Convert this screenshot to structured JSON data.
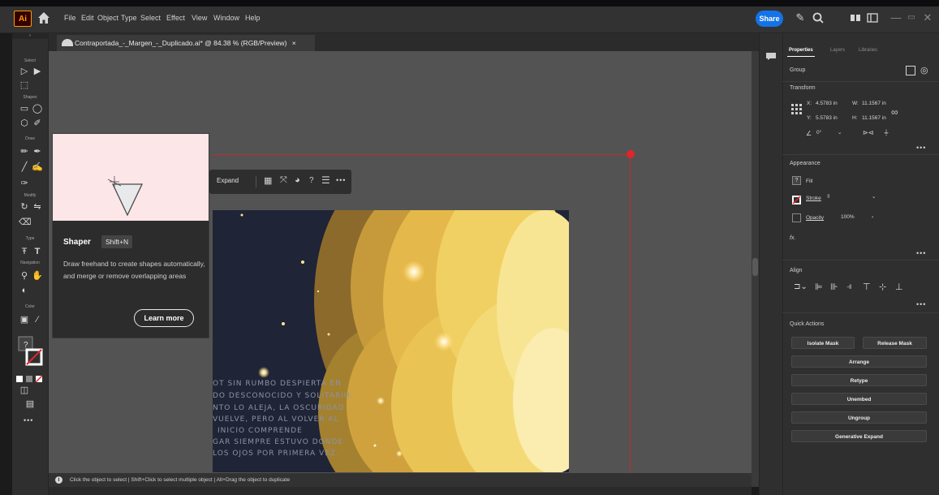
{
  "app": {
    "logo_text": "Ai",
    "menu": [
      "File",
      "Edit",
      "Object",
      "Type",
      "Select",
      "Effect",
      "View",
      "Window",
      "Help"
    ],
    "share_label": "Share"
  },
  "document": {
    "tab_title": "Contraportada_-_Margen_-_Duplicado.ai* @ 84.38 % (RGB/Preview)",
    "close_glyph": "×"
  },
  "toolbar": {
    "sections": [
      "Select",
      "Shapes",
      "Draw",
      "Modify",
      "Type",
      "Navigation",
      "Color"
    ]
  },
  "context_bar": {
    "expand_label": "Expand"
  },
  "tooltip": {
    "title": "Shaper",
    "shortcut": "Shift+N",
    "description": "Draw freehand to create shapes automatically, and merge or remove overlapping areas",
    "learn_more": "Learn more"
  },
  "artboard_text": [
    "OT SIN RUMBO DESPIERTA EN",
    "DO DESCONOCIDO Y SOLITARIO.",
    "NTO LO ALEJA, LA OSCURIDAD",
    "VUELVE, PERO AL VOLVER AL",
    "INICIO COMPRENDE",
    "GAR SIEMPRE ESTUVO DONDE",
    "LOS OJOS POR PRIMERA VEZ."
  ],
  "status": {
    "text": "Click the object to select  |  Shift+Click to select multiple object  |  Alt+Drag the object to duplicate"
  },
  "properties": {
    "tabs": [
      "Properties",
      "Layers",
      "Libraries"
    ],
    "selection_type": "Group",
    "transform_label": "Transform",
    "x_label": "X:",
    "x_value": "4.5783 in",
    "y_label": "Y:",
    "y_value": "5.5783 in",
    "w_label": "W:",
    "w_value": "11.1567 in",
    "h_label": "H:",
    "h_value": "11.1567 in",
    "angle_value": "0°",
    "appearance_label": "Appearance",
    "fill_label": "Fill",
    "stroke_label": "Stroke",
    "opacity_label": "Opacity",
    "opacity_value": "100%",
    "fx_label": "fx.",
    "align_label": "Align",
    "quick_actions_label": "Quick Actions",
    "buttons": {
      "isolate_mask": "Isolate Mask",
      "release_mask": "Release Mask",
      "arrange": "Arrange",
      "retype": "Retype",
      "unembed": "Unembed",
      "ungroup": "Ungroup",
      "generative_expand": "Generative Expand"
    }
  },
  "colors": {
    "accent": "#1473e6",
    "selection": "#c72a2a",
    "tooltip_preview": "#fde6e8",
    "artboard_night": "#1f2436",
    "art_yellow": "#f3d66a"
  }
}
